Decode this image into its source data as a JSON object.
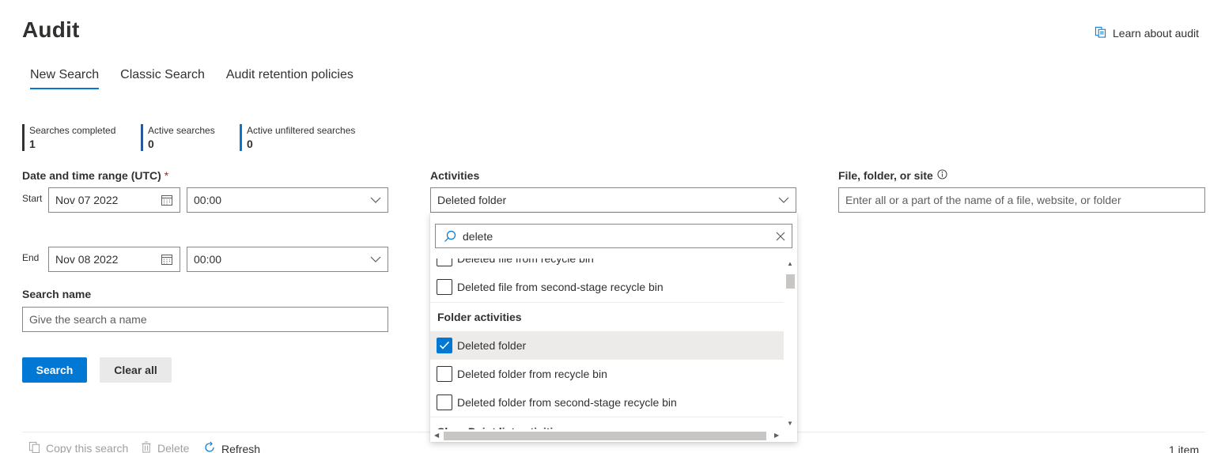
{
  "header": {
    "title": "Audit",
    "learn_link": "Learn about audit"
  },
  "tabs": [
    {
      "label": "New Search",
      "active": true
    },
    {
      "label": "Classic Search",
      "active": false
    },
    {
      "label": "Audit retention policies",
      "active": false
    }
  ],
  "metrics": [
    {
      "label": "Searches completed",
      "value": "1",
      "color": "#323130"
    },
    {
      "label": "Active searches",
      "value": "0",
      "color": "#2b579a"
    },
    {
      "label": "Active unfiltered searches",
      "value": "0",
      "color": "#0078d4"
    }
  ],
  "form": {
    "date_range_label": "Date and time range (UTC)",
    "required_mark": "*",
    "start_label": "Start",
    "start_date": "Nov 07 2022",
    "start_time": "00:00",
    "end_label": "End",
    "end_date": "Nov 08 2022",
    "end_time": "00:00",
    "search_name_label": "Search name",
    "search_name_placeholder": "Give the search a name",
    "activities_label": "Activities",
    "activities_value": "Deleted folder",
    "file_label": "File, folder, or site",
    "file_placeholder": "Enter all or a part of the name of a file, website, or folder"
  },
  "buttons": {
    "search": "Search",
    "clear_all": "Clear all"
  },
  "dropdown": {
    "search_text": "delete",
    "items": [
      {
        "type": "option",
        "label": "Deleted file from recycle bin",
        "checked": false
      },
      {
        "type": "option",
        "label": "Deleted file from second-stage recycle bin",
        "checked": false
      },
      {
        "type": "header",
        "label": "Folder activities"
      },
      {
        "type": "option",
        "label": "Deleted folder",
        "checked": true
      },
      {
        "type": "option",
        "label": "Deleted folder from recycle bin",
        "checked": false
      },
      {
        "type": "option",
        "label": "Deleted folder from second-stage recycle bin",
        "checked": false
      },
      {
        "type": "header",
        "label": "SharePoint list activities"
      }
    ]
  },
  "toolbar": {
    "copy": "Copy this search",
    "delete": "Delete",
    "refresh": "Refresh",
    "item_count": "1 item"
  },
  "colors": {
    "accent": "#0078d4",
    "text": "#323130",
    "disabled": "#a19f9d"
  }
}
